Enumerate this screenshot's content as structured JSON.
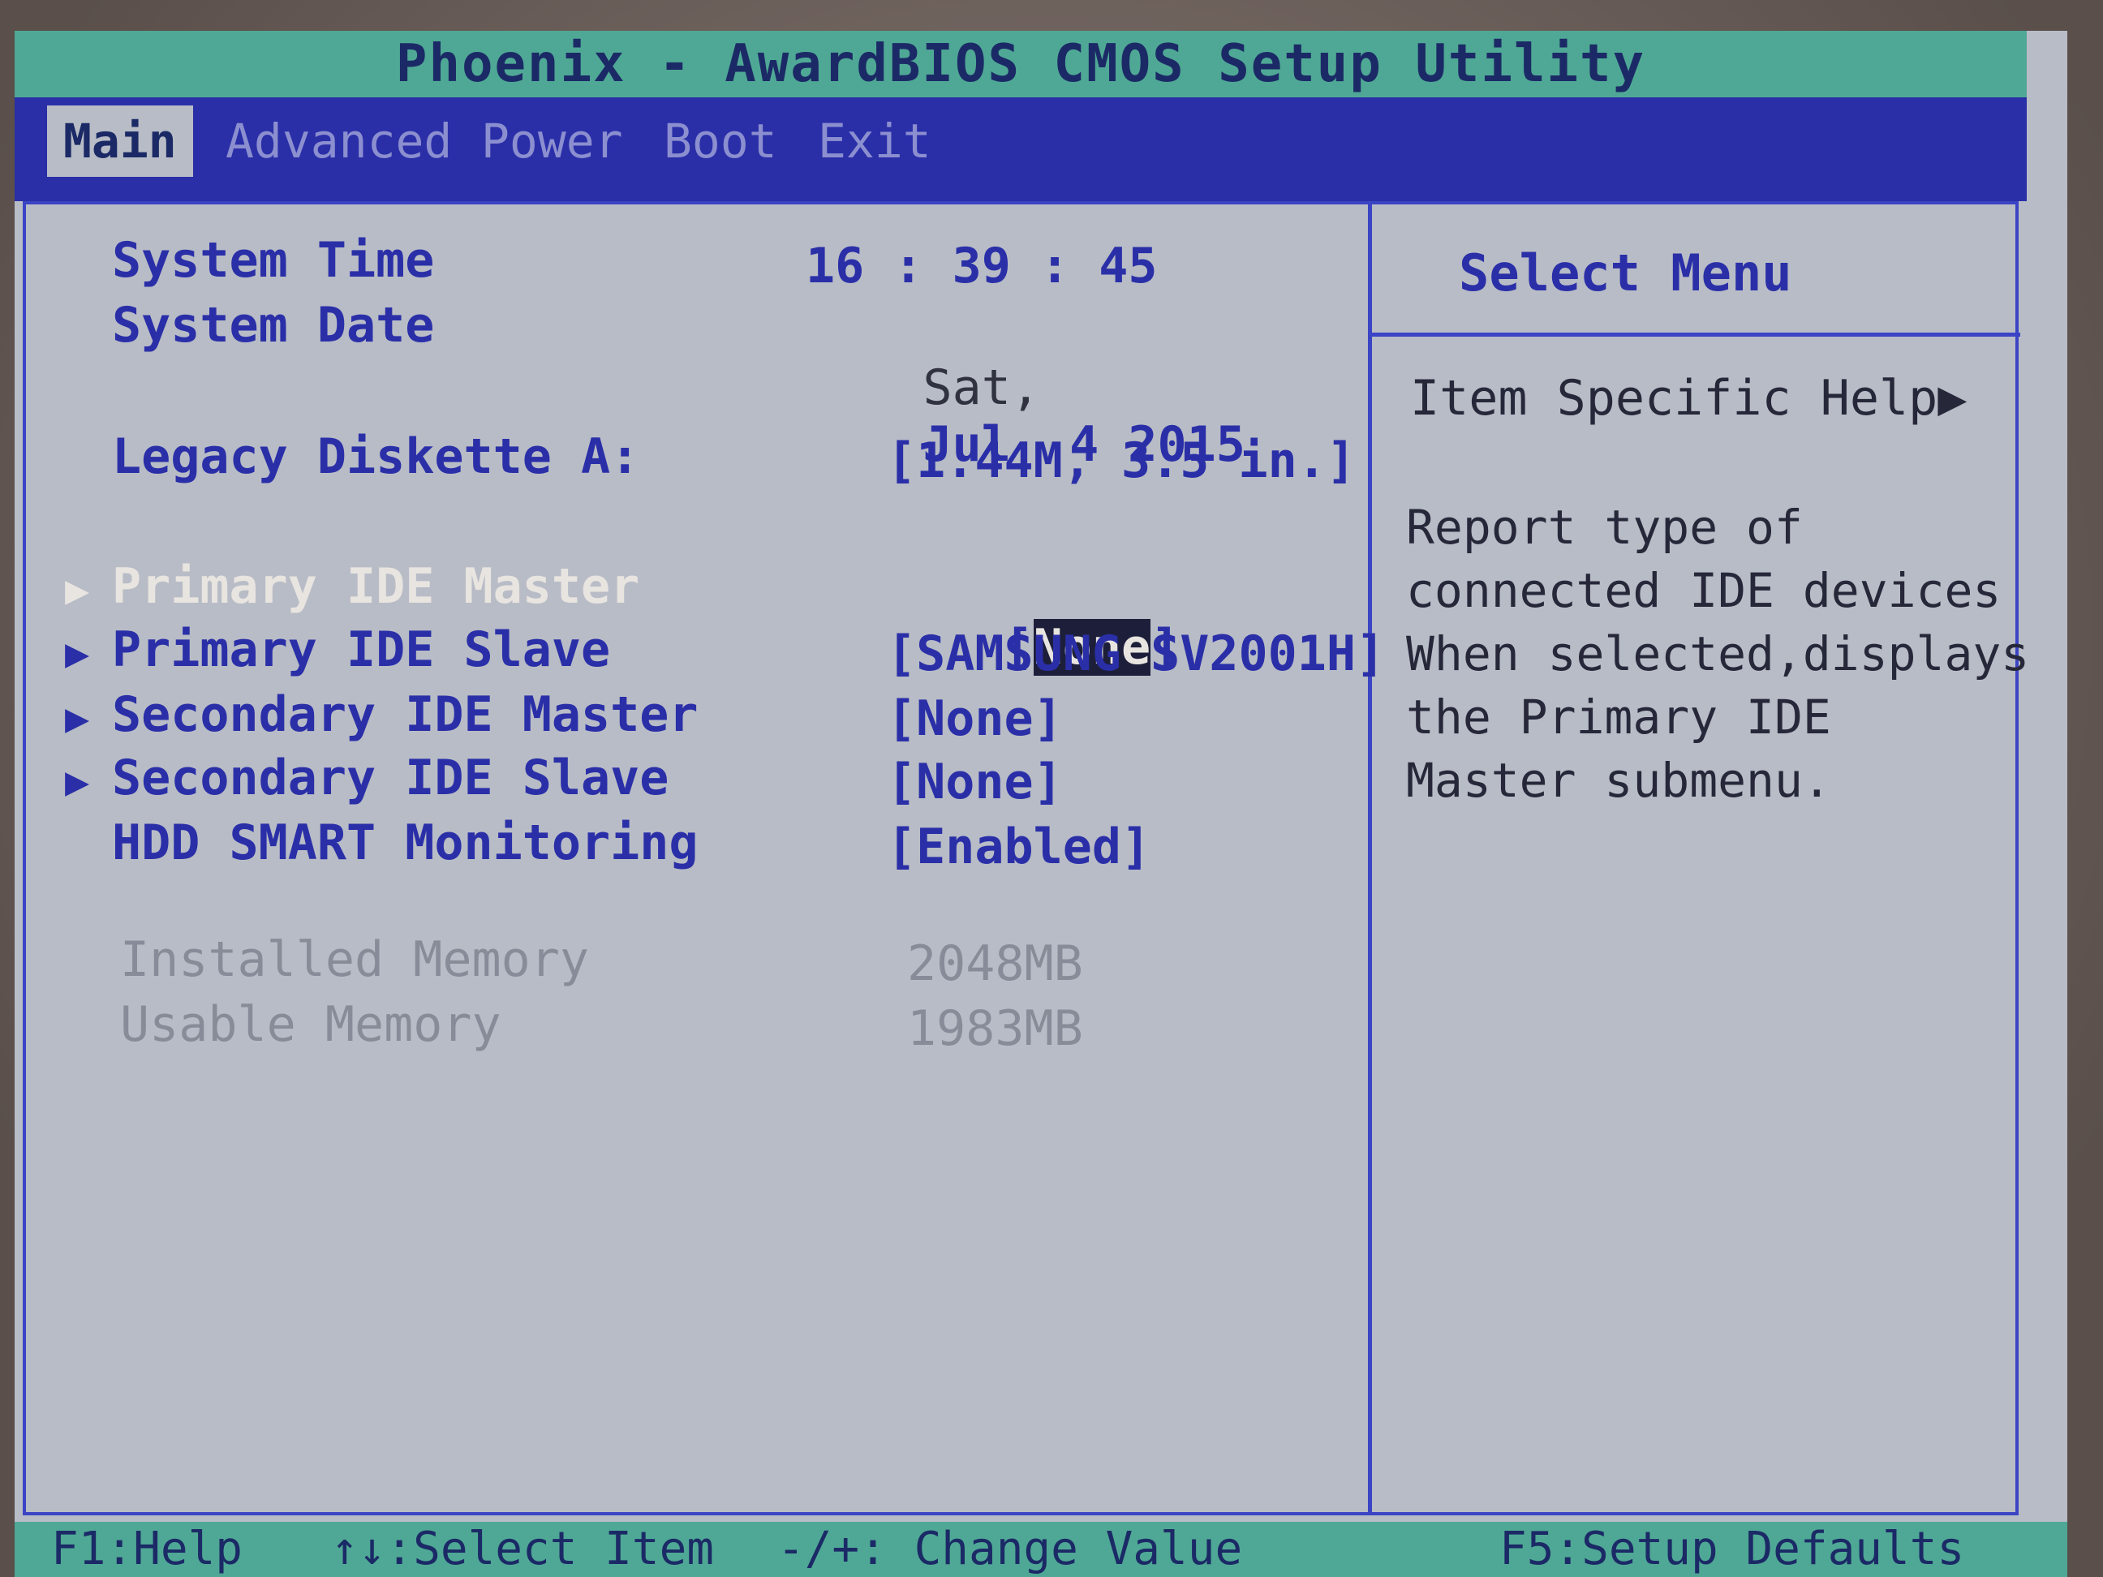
{
  "header": {
    "title": "Phoenix - AwardBIOS CMOS Setup Utility"
  },
  "menu": {
    "items": [
      {
        "label": "Main"
      },
      {
        "label": "Advanced"
      },
      {
        "label": "Power"
      },
      {
        "label": "Boot"
      },
      {
        "label": "Exit"
      }
    ],
    "selected": "Main"
  },
  "main": {
    "system_time": {
      "label": "System Time",
      "value": "16 : 39 : 45"
    },
    "system_date": {
      "label": "System Date",
      "day": "Sat,",
      "value": "Jul  4 2015"
    },
    "legacy_diskette": {
      "label": "Legacy Diskette A:",
      "value": "[1.44M, 3.5 in.]"
    },
    "primary_master": {
      "label": "Primary IDE Master",
      "open": "[",
      "value": "None",
      "close": "]"
    },
    "primary_slave": {
      "label": "Primary IDE Slave",
      "value": "[SAMSUNG SV2001H]"
    },
    "secondary_master": {
      "label": "Secondary IDE Master",
      "value": "[None]"
    },
    "secondary_slave": {
      "label": "Secondary IDE Slave",
      "value": "[None]"
    },
    "hdd_smart": {
      "label": "HDD SMART Monitoring",
      "value": "[Enabled]"
    },
    "installed_memory": {
      "label": "Installed Memory",
      "value": "2048MB"
    },
    "usable_memory": {
      "label": "Usable Memory",
      "value": "1983MB"
    },
    "submenu_arrow": "▶"
  },
  "help": {
    "title": "Select Menu",
    "subtitle": "Item Specific Help",
    "subtitle_arrow": "▶",
    "lines": [
      "Report type of",
      "connected IDE devices",
      "When selected,displays",
      "the Primary IDE",
      "Master submenu."
    ]
  },
  "footer": {
    "help": "F1:Help",
    "select_item": "↑↓:Select Item",
    "change_value": "-/+: Change Value",
    "setup_defaults": "F5:Setup Defaults"
  },
  "colors": {
    "title_bar": "#4fa895",
    "menu_bar": "#2a2fa8",
    "panel_bg": "#b8bcc6",
    "text_blue": "#2a2fa8",
    "highlight_bg": "#1d1f3a"
  }
}
